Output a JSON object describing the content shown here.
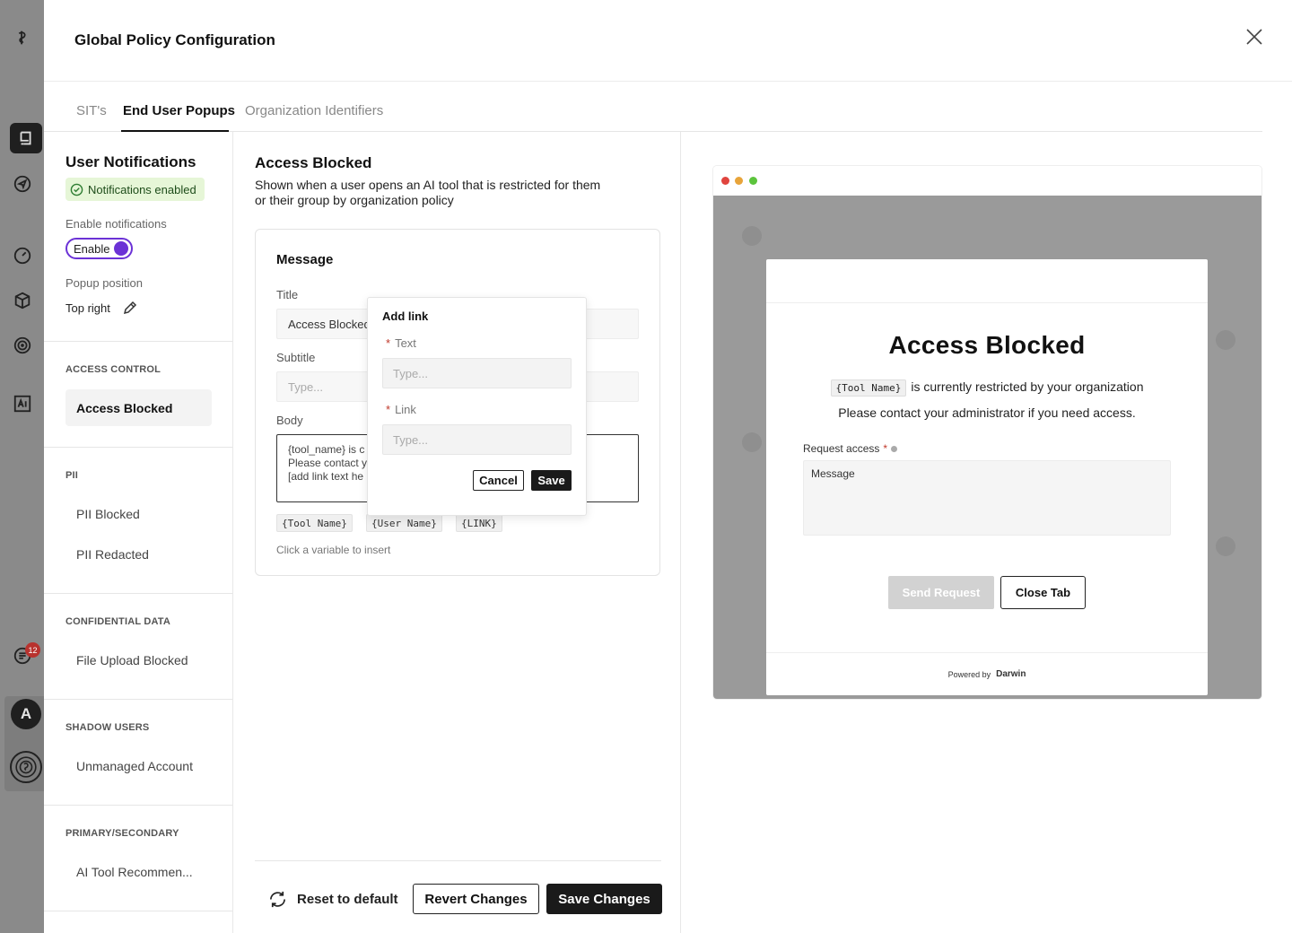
{
  "modal": {
    "title": "Global Policy Configuration"
  },
  "tabs": [
    "SIT's",
    "End User Popups",
    "Organization Identifiers"
  ],
  "rail": {
    "badge_count": "12",
    "avatar_letter": "A"
  },
  "sidebar": {
    "heading": "User Notifications",
    "status": "Notifications enabled",
    "enable_label": "Enable notifications",
    "toggle_label": "Enable",
    "position_label": "Popup position",
    "position_value": "Top right",
    "categories": [
      {
        "name": "ACCESS CONTROL",
        "items": [
          "Access Blocked"
        ]
      },
      {
        "name": "PII",
        "items": [
          "PII Blocked",
          "PII Redacted"
        ]
      },
      {
        "name": "CONFIDENTIAL DATA",
        "items": [
          "File Upload Blocked"
        ]
      },
      {
        "name": "SHADOW USERS",
        "items": [
          "Unmanaged Account"
        ]
      },
      {
        "name": "PRIMARY/SECONDARY",
        "items": [
          "AI Tool Recommen..."
        ]
      }
    ]
  },
  "editor": {
    "heading": "Access Blocked",
    "description": "Shown when a user opens an AI tool that is restricted for them or their group by organization policy",
    "card_title": "Message",
    "title_label": "Title",
    "title_value": "Access Blocked",
    "subtitle_label": "Subtitle",
    "subtitle_placeholder": "Type...",
    "body_label": "Body",
    "body_value": "{tool_name} is c\nPlease contact y\n[add link text he",
    "variables": [
      "{Tool Name}",
      "{User Name}",
      "{LINK}"
    ],
    "variables_hint": "Click a variable to insert"
  },
  "add_link": {
    "title": "Add link",
    "text_label": "Text",
    "text_placeholder": "Type...",
    "link_label": "Link",
    "link_placeholder": "Type...",
    "cancel": "Cancel",
    "save": "Save"
  },
  "footer": {
    "reset": "Reset to default",
    "revert": "Revert Changes",
    "save": "Save Changes"
  },
  "preview": {
    "heading": "Access Blocked",
    "token": "{Tool Name}",
    "line1": "is currently restricted by your organization",
    "line2": "Please contact your administrator if you need access.",
    "request_label": "Request access",
    "message_placeholder": "Message",
    "send": "Send Request",
    "close": "Close Tab",
    "powered_by": "Powered by",
    "brand": "Darwin"
  },
  "colors": {
    "accent": "#6b32d6",
    "dark": "#1a1a1a",
    "success_bg": "#e6f6d7"
  }
}
